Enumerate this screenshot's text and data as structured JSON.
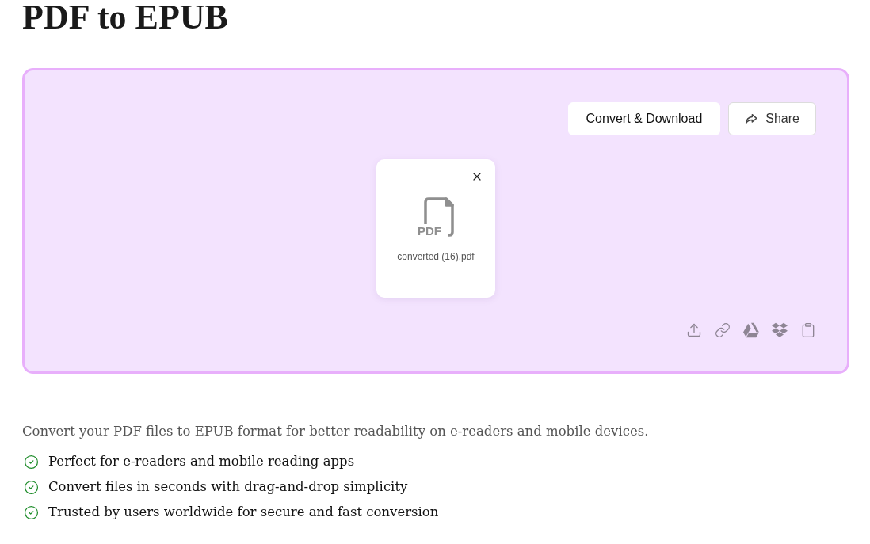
{
  "title": "PDF to EPUB",
  "actions": [
    {
      "kind": "primary",
      "label": "Convert & Download"
    },
    {
      "kind": "share",
      "label": "Share"
    }
  ],
  "file": {
    "type_label": "PDF",
    "name": "converted (16).pdf"
  },
  "description": "Convert your PDF files to EPUB format for better readability on e-readers and mobile devices.",
  "features": [
    "Perfect for e-readers and mobile reading apps",
    "Convert files in seconds with drag-and-drop simplicity",
    "Trusted by users worldwide for secure and fast conversion"
  ]
}
